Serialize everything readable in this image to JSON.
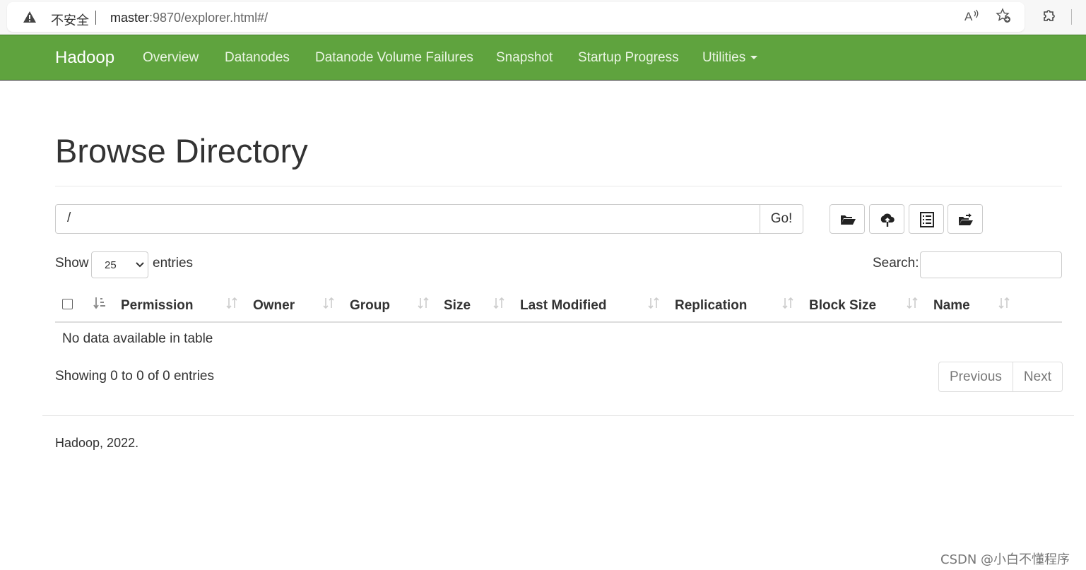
{
  "browser": {
    "security_label": "不安全",
    "url_host": "master",
    "url_rest": ":9870/explorer.html#/"
  },
  "navbar": {
    "brand": "Hadoop",
    "items": [
      {
        "label": "Overview"
      },
      {
        "label": "Datanodes"
      },
      {
        "label": "Datanode Volume Failures"
      },
      {
        "label": "Snapshot"
      },
      {
        "label": "Startup Progress"
      },
      {
        "label": "Utilities"
      }
    ],
    "color": "#5fa33e"
  },
  "page": {
    "title": "Browse Directory",
    "path_value": "/",
    "go_label": "Go!",
    "tools": [
      "folder-open-icon",
      "cloud-upload-icon",
      "list-icon",
      "folder-move-icon"
    ]
  },
  "table": {
    "show_label": "Show",
    "entries_value": "25",
    "entries_label": "entries",
    "search_label": "Search:",
    "columns": [
      "Permission",
      "Owner",
      "Group",
      "Size",
      "Last Modified",
      "Replication",
      "Block Size",
      "Name"
    ],
    "empty_message": "No data available in table",
    "info": "Showing 0 to 0 of 0 entries",
    "prev_label": "Previous",
    "next_label": "Next"
  },
  "footer": {
    "text": "Hadoop, 2022."
  },
  "watermark": "CSDN @小白不懂程序"
}
